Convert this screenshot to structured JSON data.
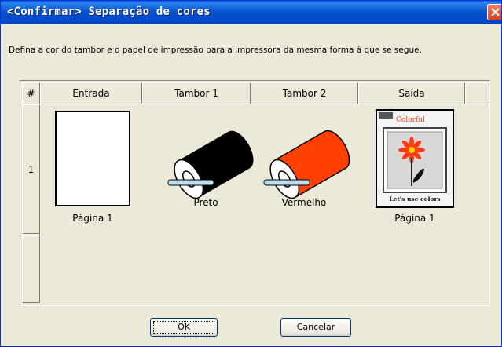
{
  "window": {
    "title": "<Confirmar> Separação de cores",
    "instruction": "Defina a cor do tambor e o papel de impressão para a impressora da mesma forma à que se segue."
  },
  "table": {
    "headers": [
      "#",
      "Entrada",
      "Tambor 1",
      "Tambor 2",
      "Saída",
      ""
    ],
    "row": {
      "number": "1",
      "input_label": "Página 1",
      "drum1_label": "Preto",
      "drum1_color": "#000000",
      "drum2_label": "Vermelho",
      "drum2_color": "#ff4000",
      "output_label": "Página 1",
      "output_preview": {
        "header_text": "Colorful",
        "footer_text": "Let's use colors",
        "flower_color": "#ff3a10"
      }
    }
  },
  "buttons": {
    "ok": "OK",
    "cancel": "Cancelar"
  }
}
